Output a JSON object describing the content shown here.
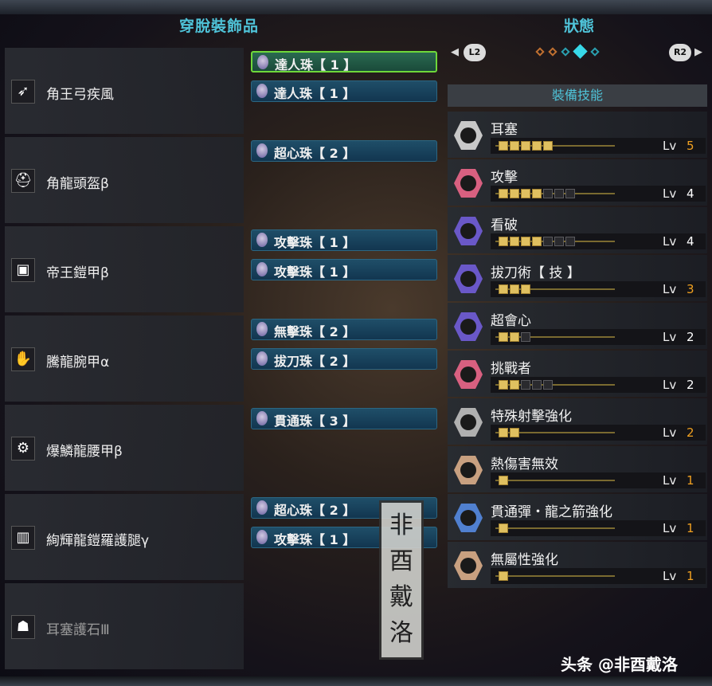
{
  "left_title": "穿脫裝飾品",
  "right_title": "狀態",
  "nav": {
    "left_btn": "L2",
    "right_btn": "R2",
    "left_arrow": "◀",
    "right_arrow": "▶"
  },
  "skills_header": "裝備技能",
  "equipment": [
    {
      "name": "角王弓疾風",
      "icon": "bow-icon",
      "decorations": [
        "達人珠【 1 】",
        "達人珠【 1 】"
      ]
    },
    {
      "name": "角龍頭盔β",
      "icon": "helmet-icon",
      "decorations": [
        "超心珠【 2 】"
      ]
    },
    {
      "name": "帝王鎧甲β",
      "icon": "chest-armor-icon",
      "decorations": [
        "攻擊珠【 1 】",
        "攻擊珠【 1 】"
      ]
    },
    {
      "name": "騰龍腕甲α",
      "icon": "gauntlet-icon",
      "decorations": [
        "無擊珠【 2 】",
        "拔刀珠【 2 】"
      ]
    },
    {
      "name": "爆鱗龍腰甲β",
      "icon": "waist-icon",
      "decorations": [
        "貫通珠【 3 】"
      ]
    },
    {
      "name": "絢輝龍鎧羅護腿γ",
      "icon": "legs-icon",
      "decorations": [
        "超心珠【 2 】",
        "攻擊珠【 1 】"
      ]
    },
    {
      "name": "耳塞護石Ⅲ",
      "icon": "charm-icon",
      "decorations": []
    }
  ],
  "skills": [
    {
      "name": "耳塞",
      "level": 5,
      "max": 5,
      "color": "#c8c8c8"
    },
    {
      "name": "攻擊",
      "level": 4,
      "max": 7,
      "color": "#d86080"
    },
    {
      "name": "看破",
      "level": 4,
      "max": 7,
      "color": "#6a58c8"
    },
    {
      "name": "拔刀術【 技 】",
      "level": 3,
      "max": 3,
      "color": "#6a58c8"
    },
    {
      "name": "超會心",
      "level": 2,
      "max": 3,
      "color": "#6a58c8"
    },
    {
      "name": "挑戰者",
      "level": 2,
      "max": 5,
      "color": "#d86080"
    },
    {
      "name": "特殊射擊強化",
      "level": 2,
      "max": 2,
      "color": "#b0b0b0"
    },
    {
      "name": "熱傷害無效",
      "level": 1,
      "max": 1,
      "color": "#c8a080"
    },
    {
      "name": "貫通彈・龍之箭強化",
      "level": 1,
      "max": 1,
      "color": "#5080d0"
    },
    {
      "name": "無屬性強化",
      "level": 1,
      "max": 1,
      "color": "#c8a080"
    }
  ],
  "lv_label": "Lv",
  "stamp_text": "非酉戴洛",
  "watermark": "头条 @非酉戴洛",
  "colors": {
    "accent": "#4fc3d8",
    "max_level": "#f0a020",
    "selected_border": "#6ed83a"
  }
}
